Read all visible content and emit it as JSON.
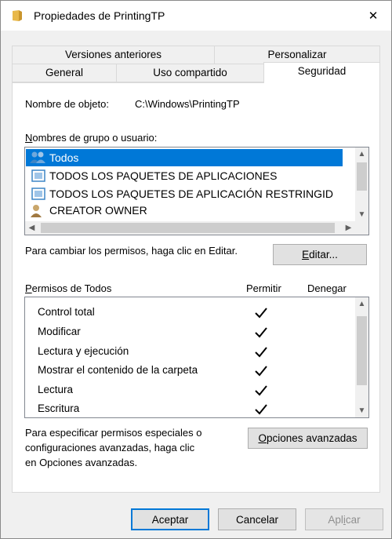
{
  "window": {
    "title": "Propiedades de PrintingTP",
    "close_glyph": "✕"
  },
  "tabs": {
    "row1": [
      "Versiones anteriores",
      "Personalizar"
    ],
    "row2": [
      "General",
      "Uso compartido",
      "Seguridad"
    ],
    "active": "Seguridad"
  },
  "object": {
    "label": "Nombre de objeto:",
    "value": "C:\\Windows\\PrintingTP"
  },
  "groups": {
    "label_first": "N",
    "label_rest": "ombres de grupo o usuario:",
    "items": [
      {
        "name": "Todos",
        "icon": "users-icon",
        "selected": true
      },
      {
        "name": "TODOS LOS PAQUETES DE APLICACIONES",
        "icon": "app-package-icon",
        "selected": false
      },
      {
        "name": "TODOS LOS PAQUETES DE APLICACIÓN RESTRINGID",
        "icon": "app-package-icon",
        "selected": false
      },
      {
        "name": "CREATOR OWNER",
        "icon": "user-icon",
        "selected": false
      }
    ]
  },
  "edit": {
    "hint": "Para cambiar los permisos, haga clic en Editar.",
    "button_first": "E",
    "button_rest": "ditar..."
  },
  "permissions": {
    "label_first": "P",
    "label_rest": "ermisos de Todos",
    "allow_header": "Permitir",
    "deny_header": "Denegar",
    "rows": [
      {
        "name": "Control total",
        "allow": true,
        "deny": false
      },
      {
        "name": "Modificar",
        "allow": true,
        "deny": false
      },
      {
        "name": "Lectura y ejecución",
        "allow": true,
        "deny": false
      },
      {
        "name": "Mostrar el contenido de la carpeta",
        "allow": true,
        "deny": false
      },
      {
        "name": "Lectura",
        "allow": true,
        "deny": false
      },
      {
        "name": "Escritura",
        "allow": true,
        "deny": false
      }
    ]
  },
  "advanced": {
    "hint_lines": [
      "Para especificar permisos especiales o",
      "configuraciones avanzadas, haga clic",
      "en Opciones avanzadas."
    ],
    "button_first": "O",
    "button_rest": "pciones avanzadas"
  },
  "footer": {
    "ok": "Aceptar",
    "cancel": "Cancelar",
    "apply_first": "Apl",
    "apply_u": "i",
    "apply_rest": "car"
  },
  "colors": {
    "selection": "#0078d7",
    "default_button_border": "#0078d7"
  }
}
